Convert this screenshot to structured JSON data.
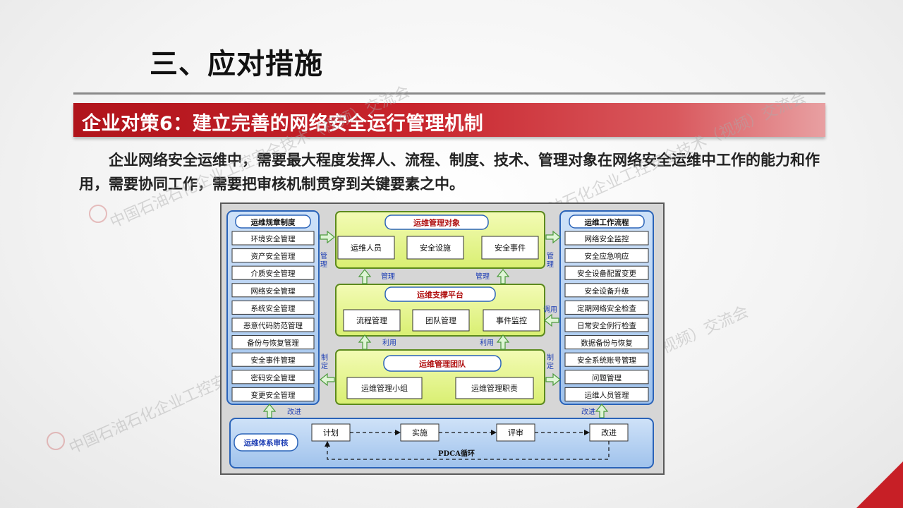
{
  "slide": {
    "title": "三、应对措施",
    "banner": "企业对策6：建立完善的网络安全运行管理机制",
    "intro": "企业网络安全运维中，需要最大程度发挥人、流程、制度、技术、管理对象在网络安全运维中工作的能力和作用，需要协同工作，需要把审核机制贯穿到关键要素之中。",
    "watermark": "中国石油石化企业工控安全技术（视频）交流会"
  },
  "diagram": {
    "left_panel": {
      "title": "运维规章制度",
      "items": [
        "环境安全管理",
        "资产安全管理",
        "介质安全管理",
        "网络安全管理",
        "系统安全管理",
        "恶意代码防范管理",
        "备份与恢复管理",
        "安全事件管理",
        "密码安全管理",
        "变更安全管理"
      ]
    },
    "right_panel": {
      "title": "运维工作流程",
      "items": [
        "网络安全监控",
        "安全应急响应",
        "安全设备配置变更",
        "安全设备升级",
        "定期网络安全检查",
        "日常安全例行检查",
        "数据备份与恢复",
        "安全系统账号管理",
        "问题管理",
        "运维人员管理"
      ]
    },
    "center_top": {
      "title": "运维管理对象",
      "items": [
        "运维人员",
        "安全设施",
        "安全事件"
      ]
    },
    "center_mid": {
      "title": "运维支撑平台",
      "items": [
        "流程管理",
        "团队管理",
        "事件监控"
      ]
    },
    "center_bot": {
      "title": "运维管理团队",
      "items": [
        "运维管理小组",
        "运维管理职责"
      ]
    },
    "bottom_panel": {
      "title": "运维体系审核",
      "steps": [
        "计划",
        "实施",
        "评审",
        "改进"
      ],
      "cycle_label": "PDCA循环"
    },
    "labels": {
      "manage": "管理",
      "use": "利用",
      "invoke": "调用",
      "formulate": "制定",
      "improve": "改进"
    },
    "colors": {
      "frame_bg": "#d4d4d4",
      "blue_panel": "#b9d4f2",
      "blue_border": "#2a63b8",
      "green_box": "#e9f79a",
      "green_border": "#5c8a1e",
      "arrow_fill": "#dff5d6",
      "arrow_stroke": "#4c9a3c",
      "label_blue": "#1f3fb4"
    }
  }
}
